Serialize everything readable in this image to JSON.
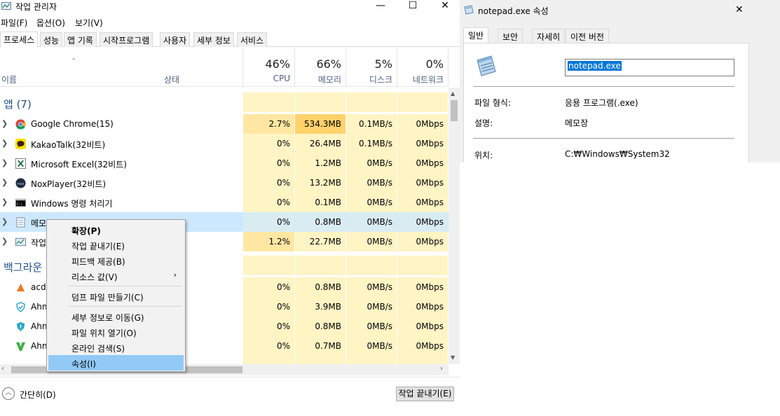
{
  "task_manager": {
    "title": "작업 관리자",
    "window_controls": {
      "minimize": "—",
      "maximize": "☐",
      "close": "✕"
    },
    "menu": [
      "파일(F)",
      "옵션(O)",
      "보기(V)"
    ],
    "tabs": [
      "프로세스",
      "성능",
      "앱 기록",
      "시작프로그램",
      "사용자",
      "세부 정보",
      "서비스"
    ],
    "active_tab": "프로세스",
    "columns": {
      "name": "이름",
      "status": "상태",
      "cpu": {
        "pct": "46%",
        "label": "CPU"
      },
      "memory": {
        "pct": "66%",
        "label": "메모리"
      },
      "disk": {
        "pct": "5%",
        "label": "디스크"
      },
      "network": {
        "pct": "0%",
        "label": "네트워크"
      }
    },
    "apps_group": "앱 (7)",
    "background_group": "백그라운",
    "apps": [
      {
        "name": "Google Chrome(15)",
        "icon": "chrome-icon",
        "cpu": "2.7%",
        "mem": "534.3MB",
        "disk": "0.1MB/s",
        "net": "0Mbps"
      },
      {
        "name": "KakaoTalk(32비트)",
        "icon": "kakaotalk-icon",
        "cpu": "0%",
        "mem": "26.4MB",
        "disk": "0.1MB/s",
        "net": "0Mbps"
      },
      {
        "name": "Microsoft Excel(32비트)",
        "icon": "excel-icon",
        "cpu": "0%",
        "mem": "1.2MB",
        "disk": "0MB/s",
        "net": "0Mbps"
      },
      {
        "name": "NoxPlayer(32비트)",
        "icon": "nox-icon",
        "cpu": "0%",
        "mem": "13.2MB",
        "disk": "0MB/s",
        "net": "0Mbps"
      },
      {
        "name": "Windows 명령 처리기",
        "icon": "cmd-icon",
        "cpu": "0%",
        "mem": "0.1MB",
        "disk": "0MB/s",
        "net": "0Mbps"
      },
      {
        "name": "메모장",
        "icon": "notepad-icon",
        "cpu": "0%",
        "mem": "0.8MB",
        "disk": "0MB/s",
        "net": "0Mbps"
      },
      {
        "name": "작업",
        "icon": "taskmgr-icon",
        "cpu": "1.2%",
        "mem": "22.7MB",
        "disk": "0MB/s",
        "net": "0Mbps"
      }
    ],
    "background": [
      {
        "name": "acdi",
        "icon": "acdsee-icon",
        "cpu": "0%",
        "mem": "0.8MB",
        "disk": "0MB/s",
        "net": "0Mbps"
      },
      {
        "name": "Ahn",
        "icon": "ahnlab-shield-icon",
        "cpu": "0%",
        "mem": "3.9MB",
        "disk": "0MB/s",
        "net": "0Mbps"
      },
      {
        "name": "Ahn",
        "icon": "ahnlab-shield-icon",
        "cpu": "0%",
        "mem": "0.8MB",
        "disk": "0MB/s",
        "net": "0Mbps"
      },
      {
        "name": "Ahn",
        "icon": "ahnlab-v-icon",
        "cpu": "0%",
        "mem": "0.7MB",
        "disk": "0MB/s",
        "net": "0Mbps"
      }
    ],
    "footer": {
      "fewer_details": "간단히(D)",
      "end_task": "작업 끝내기(E)"
    }
  },
  "context_menu": {
    "items": [
      {
        "label": "확장(P)",
        "bold": true
      },
      {
        "label": "작업 끝내기(E)"
      },
      {
        "label": "피드백 제공(B)"
      },
      {
        "label": "리소스 값(V)",
        "submenu": true
      },
      {
        "label": "덤프 파일 만들기(C)"
      },
      {
        "label": "세부 정보로 이동(G)"
      },
      {
        "label": "파일 위치 열기(O)"
      },
      {
        "label": "온라인 검색(S)"
      },
      {
        "label": "속성(I)",
        "highlighted": true
      }
    ],
    "submenu_arrow": "›"
  },
  "properties": {
    "title": "notepad.exe 속성",
    "close": "✕",
    "tabs": [
      "일반",
      "보안",
      "자세히",
      "이전 버전"
    ],
    "active_tab": "일반",
    "file_name": "notepad.exe",
    "file_type_label": "파일 형식:",
    "file_type_value": "응용 프로그램(.exe)",
    "description_label": "설명:",
    "description_value": "메모장",
    "location_label": "위치:",
    "location_value": "C:₩Windows₩System32"
  }
}
